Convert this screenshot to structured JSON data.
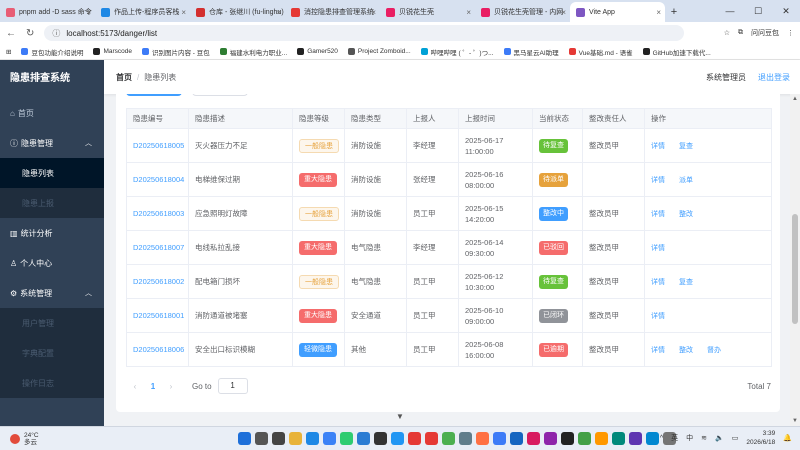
{
  "browser": {
    "tabs": [
      {
        "label": "pnpm add -D sass 命令",
        "color": "#e85d75",
        "active": false
      },
      {
        "label": "作品上传-程序员客栈",
        "color": "#1e88e5",
        "active": false
      },
      {
        "label": "仓库 - 张继川 (fu-linghu)",
        "color": "#d32f2f",
        "active": false
      },
      {
        "label": "消控隐患排查管理系统",
        "color": "#e53935",
        "active": false
      },
      {
        "label": "贝锐花生壳",
        "color": "#e91e63",
        "active": false
      },
      {
        "label": "贝锐花生壳管理 - 内网",
        "color": "#e91e63",
        "active": false
      },
      {
        "label": "Vite App",
        "color": "#7e57c2",
        "active": true
      }
    ],
    "url": "localhost:5173/danger/list",
    "right_label": "问问豆包",
    "bookmarks": [
      {
        "label": "豆包功能介绍说明",
        "color": "#3d7bf7"
      },
      {
        "label": "Marscode",
        "color": "#222"
      },
      {
        "label": "识别图片内容 - 豆包",
        "color": "#3d7bf7"
      },
      {
        "label": "福建水利电力职业...",
        "color": "#2e7d32"
      },
      {
        "label": "Gamer520",
        "color": "#222"
      },
      {
        "label": "Project Zomboid...",
        "color": "#555"
      },
      {
        "label": "哔哩哔哩 ( ゜- ゜)つ...",
        "color": "#00a1d6"
      },
      {
        "label": "黑马星云AI助理",
        "color": "#3d7bf7"
      },
      {
        "label": "Vue基础.md - 语雀",
        "color": "#e53935"
      },
      {
        "label": "GitHub加速下载代...",
        "color": "#222"
      }
    ]
  },
  "sidebar": {
    "brand": "隐患排查系统",
    "home": "首页",
    "danger_mgmt": "隐患管理",
    "danger_list": "隐患列表",
    "danger_report": "隐患上报",
    "stats": "统计分析",
    "personal": "个人中心",
    "system": "系统管理",
    "user_mgmt": "用户管理",
    "dict_cfg": "字典配置",
    "op_log": "操作日志"
  },
  "header": {
    "breadcrumb_home": "首页",
    "breadcrumb_current": "隐患列表",
    "user": "系统管理员",
    "logout": "退出登录"
  },
  "table": {
    "columns": [
      "隐患编号",
      "隐患描述",
      "隐患等级",
      "隐患类型",
      "上报人",
      "上报时间",
      "当前状态",
      "整改责任人",
      "操作"
    ],
    "rows": [
      {
        "code": "D20250618005",
        "desc": "灭火器压力不足",
        "level": "一般隐患",
        "lvl": "normal",
        "type": "消防设施",
        "reporter": "李经理",
        "date": "2025-06-17",
        "time": "11:00:00",
        "status": "待复查",
        "st": "green",
        "owner": "整改员甲",
        "ops": [
          "详情",
          "复查"
        ]
      },
      {
        "code": "D20250618004",
        "desc": "电梯维保过期",
        "level": "重大隐患",
        "lvl": "major",
        "type": "消防设施",
        "reporter": "张经理",
        "date": "2025-06-16",
        "time": "08:00:00",
        "status": "待派单",
        "st": "orange",
        "owner": "",
        "ops": [
          "详情",
          "派单"
        ]
      },
      {
        "code": "D20250618003",
        "desc": "应急照明灯故障",
        "level": "一般隐患",
        "lvl": "normal",
        "type": "消防设施",
        "reporter": "员工甲",
        "date": "2025-06-15",
        "time": "14:20:00",
        "status": "整改中",
        "st": "blue",
        "owner": "整改员甲",
        "ops": [
          "详情",
          "整改"
        ]
      },
      {
        "code": "D20250618007",
        "desc": "电线私拉乱接",
        "level": "重大隐患",
        "lvl": "major",
        "type": "电气隐患",
        "reporter": "李经理",
        "date": "2025-06-14",
        "time": "09:30:00",
        "status": "已驳回",
        "st": "red",
        "owner": "整改员甲",
        "ops": [
          "详情"
        ]
      },
      {
        "code": "D20250618002",
        "desc": "配电箱门损坏",
        "level": "一般隐患",
        "lvl": "normal",
        "type": "电气隐患",
        "reporter": "员工甲",
        "date": "2025-06-12",
        "time": "10:30:00",
        "status": "待复查",
        "st": "green",
        "owner": "整改员甲",
        "ops": [
          "详情",
          "复查"
        ]
      },
      {
        "code": "D20250618001",
        "desc": "消防通道被堵塞",
        "level": "重大隐患",
        "lvl": "major",
        "type": "安全通道",
        "reporter": "员工甲",
        "date": "2025-06-10",
        "time": "09:00:00",
        "status": "已闭环",
        "st": "gray",
        "owner": "整改员甲",
        "ops": [
          "详情"
        ]
      },
      {
        "code": "D20250618006",
        "desc": "安全出口标识模糊",
        "level": "轻微隐患",
        "lvl": "minor",
        "type": "其他",
        "reporter": "员工甲",
        "date": "2025-06-08",
        "time": "16:00:00",
        "status": "已逾期",
        "st": "red",
        "owner": "整改员甲",
        "ops": [
          "详情",
          "整改",
          "督办"
        ]
      }
    ]
  },
  "pager": {
    "current": "1",
    "goto_label": "Go to",
    "goto_value": "1",
    "total": "Total 7"
  },
  "taskbar": {
    "temp": "24°C",
    "weather": "多云",
    "lang1": "英",
    "lang2": "中",
    "time": "3:39",
    "date": "2026/6/18"
  }
}
